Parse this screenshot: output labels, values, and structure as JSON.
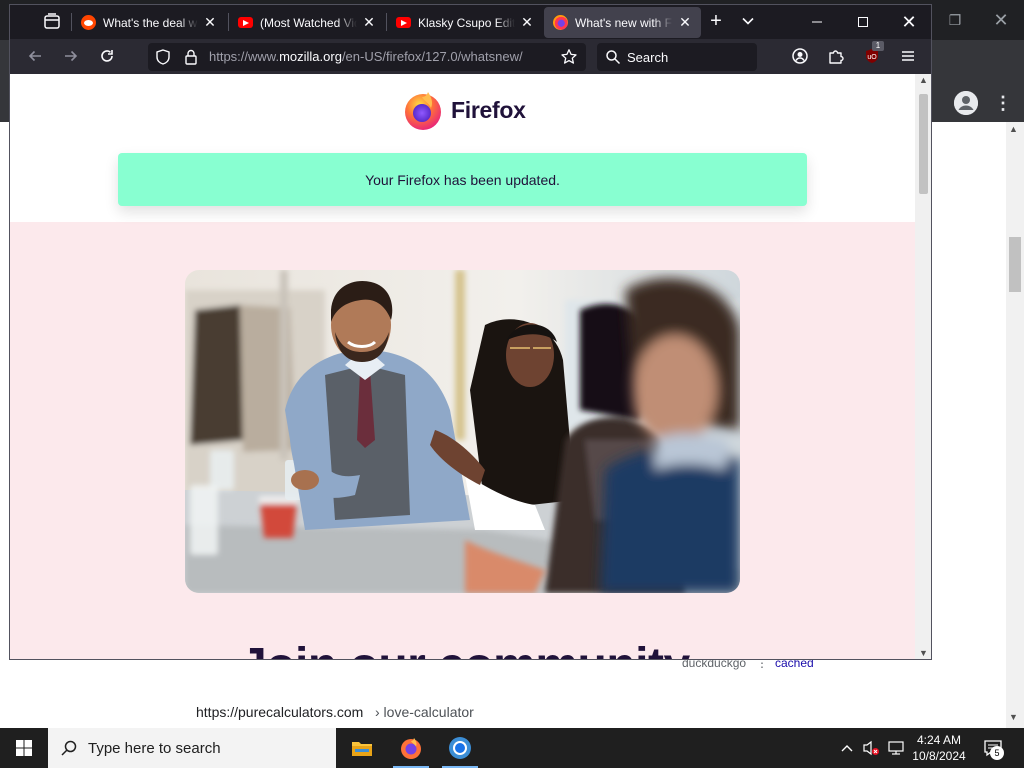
{
  "background_window": {
    "result_url": "https://purecalculators.com",
    "result_path": "› love-calculator",
    "search_engine_label": "duckduckgo",
    "cached_label": "cached"
  },
  "firefox": {
    "tabs": [
      {
        "title": "What's the deal with",
        "favicon": "reddit-icon",
        "selected": false
      },
      {
        "title": "(Most Watched Vide",
        "favicon": "youtube-icon",
        "selected": false
      },
      {
        "title": "Klasky Csupo Edited",
        "favicon": "youtube-icon",
        "selected": false
      },
      {
        "title": "What's new with Fir",
        "favicon": "firefox-icon",
        "selected": true
      }
    ],
    "url": {
      "prefix": "https://www.",
      "domain": "mozilla.org",
      "path": "/en-US/firefox/127.0/whatsnew/"
    },
    "search_placeholder": "Search",
    "ublock_badge": "1"
  },
  "page": {
    "brand_name": "Firefox",
    "update_message": "Your Firefox has been updated.",
    "community_heading": "Join our community",
    "colors": {
      "banner": "#88ffd1",
      "page_background": "#fce9ec",
      "heading": "#20123a"
    }
  },
  "taskbar": {
    "search_placeholder": "Type here to search",
    "time": "4:24 AM",
    "date": "10/8/2024",
    "notification_count": "5",
    "apps": [
      "file-explorer-icon",
      "firefox-icon",
      "chrome-icon"
    ]
  }
}
